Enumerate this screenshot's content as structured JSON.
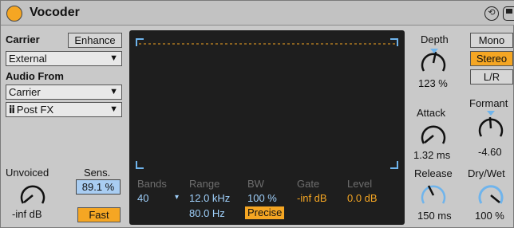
{
  "header": {
    "title": "Vocoder"
  },
  "carrier": {
    "label": "Carrier",
    "enhance_label": "Enhance",
    "source_value": "External",
    "audio_from_label": "Audio From",
    "audio_from_value": "Carrier",
    "tap_value": "Post FX"
  },
  "unvoiced": {
    "label": "Unvoiced",
    "value": "-inf dB",
    "sens_label": "Sens.",
    "sens_value": "89.1 %",
    "fast_label": "Fast"
  },
  "screen": {
    "bands_label": "Bands",
    "bands_value": "40",
    "range_label": "Range",
    "range_high": "12.0 kHz",
    "range_low": "80.0 Hz",
    "bw_label": "BW",
    "bw_value": "100 %",
    "precise_label": "Precise",
    "gate_label": "Gate",
    "gate_value": "-inf dB",
    "level_label": "Level",
    "level_value": "0.0 dB"
  },
  "right": {
    "depth_label": "Depth",
    "depth_value": "123 %",
    "attack_label": "Attack",
    "attack_value": "1.32 ms",
    "release_label": "Release",
    "release_value": "150 ms",
    "mono_label": "Mono",
    "stereo_label": "Stereo",
    "lr_label": "L/R",
    "formant_label": "Formant",
    "formant_value": "-4.60",
    "drywet_label": "Dry/Wet",
    "drywet_value": "100 %"
  },
  "colors": {
    "accent_orange": "#f5a623",
    "accent_blue": "#6fb4ec",
    "display_bg": "#1e1e1e"
  }
}
